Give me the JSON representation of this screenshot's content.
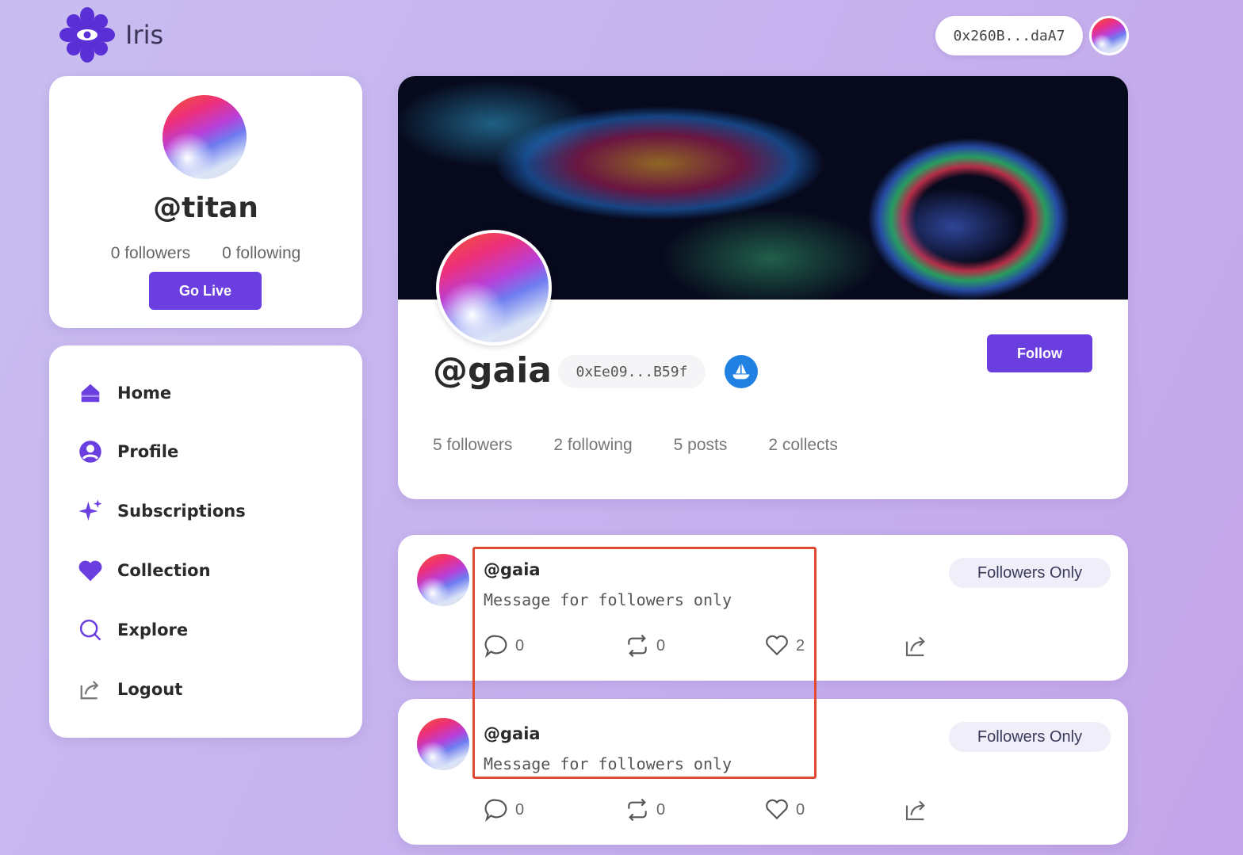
{
  "app": {
    "name": "Iris"
  },
  "header": {
    "wallet_address": "0x260B...daA7"
  },
  "left_profile": {
    "handle": "@titan",
    "followers": "0 followers",
    "following": "0 following",
    "go_live_label": "Go Live"
  },
  "nav": {
    "items": [
      {
        "label": "Home",
        "icon": "home-icon"
      },
      {
        "label": "Profile",
        "icon": "user-icon"
      },
      {
        "label": "Subscriptions",
        "icon": "sparkle-icon"
      },
      {
        "label": "Collection",
        "icon": "heart-icon"
      },
      {
        "label": "Explore",
        "icon": "search-icon"
      },
      {
        "label": "Logout",
        "icon": "logout-icon"
      }
    ]
  },
  "profile": {
    "handle": "@gaia",
    "address": "0xEe09...B59f",
    "follow_label": "Follow",
    "stats": {
      "followers": "5 followers",
      "following": "2 following",
      "posts": "5 posts",
      "collects": "2 collects"
    }
  },
  "posts": [
    {
      "handle": "@gaia",
      "message": "Message for followers only",
      "badge": "Followers Only",
      "comments": "0",
      "mirrors": "0",
      "likes": "2"
    },
    {
      "handle": "@gaia",
      "message": "Message for followers only",
      "badge": "Followers Only",
      "comments": "0",
      "mirrors": "0",
      "likes": "0"
    }
  ],
  "colors": {
    "accent": "#6b3ee0",
    "highlight": "#e04a32",
    "opensea": "#2081e2"
  }
}
